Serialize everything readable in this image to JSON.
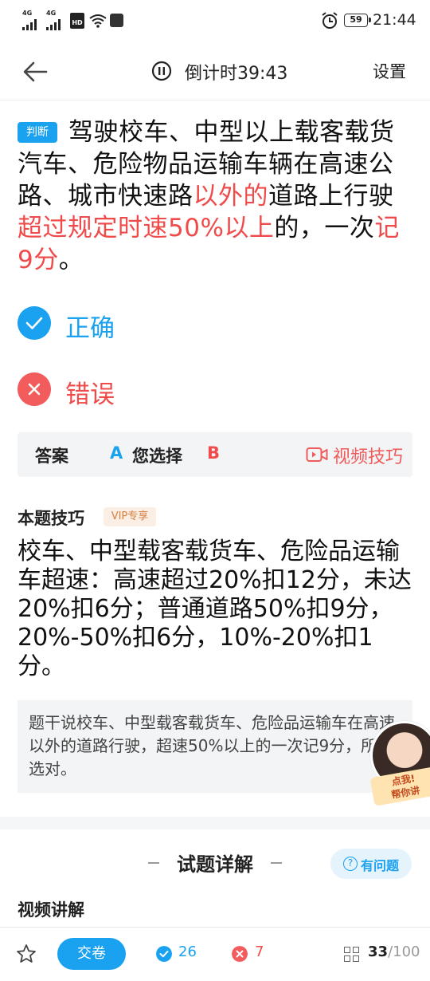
{
  "status_bar": {
    "signal1": "4G",
    "signal2": "4G",
    "hd": "HD",
    "battery": "59",
    "time": "21:44"
  },
  "header": {
    "back_icon": "arrow-left-icon",
    "pause_icon": "pause-circle-icon",
    "countdown": "倒计时39:43",
    "settings": "设置"
  },
  "question": {
    "tag": "判断",
    "parts": [
      {
        "text": "驾驶校车、中型以上载客载货汽车、危险物品运输车辆在高速公路、城市快速路",
        "highlight": false
      },
      {
        "text": "以外的",
        "highlight": true
      },
      {
        "text": "道路上行驶",
        "highlight": false
      },
      {
        "text": "超过规定时速50%以上",
        "highlight": true
      },
      {
        "text": "的，一次",
        "highlight": false
      },
      {
        "text": "记9分",
        "highlight": true
      },
      {
        "text": "。",
        "highlight": false
      }
    ]
  },
  "options": {
    "correct_label": "正确",
    "wrong_label": "错误"
  },
  "answer": {
    "answer_label": "答案",
    "answer_value": "A",
    "choice_label": "您选择",
    "choice_value": "B",
    "video_tip": "视频技巧"
  },
  "tips": {
    "title": "本题技巧",
    "vip": "VIP专享",
    "body": "校车、中型载客载货车、危险品运输车超速：高速超过20%扣12分，未达20%扣6分；普通道路50%扣9分，20%-50%扣6分，10%-20%扣1分。",
    "explain": "题干说校车、中型载客载货车、危险品运输车在高速以外的道路行驶，超速50%以上的一次记9分，所以选对。"
  },
  "avatar": {
    "badge_line1": "点我!",
    "badge_line2": "帮你讲"
  },
  "detail": {
    "title": "试题详解",
    "ask": "有问题",
    "video_title": "视频讲解"
  },
  "bottom": {
    "submit": "交卷",
    "correct_count": "26",
    "wrong_count": "7",
    "current": "33",
    "total": "/100"
  },
  "colors": {
    "accent": "#1aa1f0",
    "error": "#ef4b4b"
  }
}
